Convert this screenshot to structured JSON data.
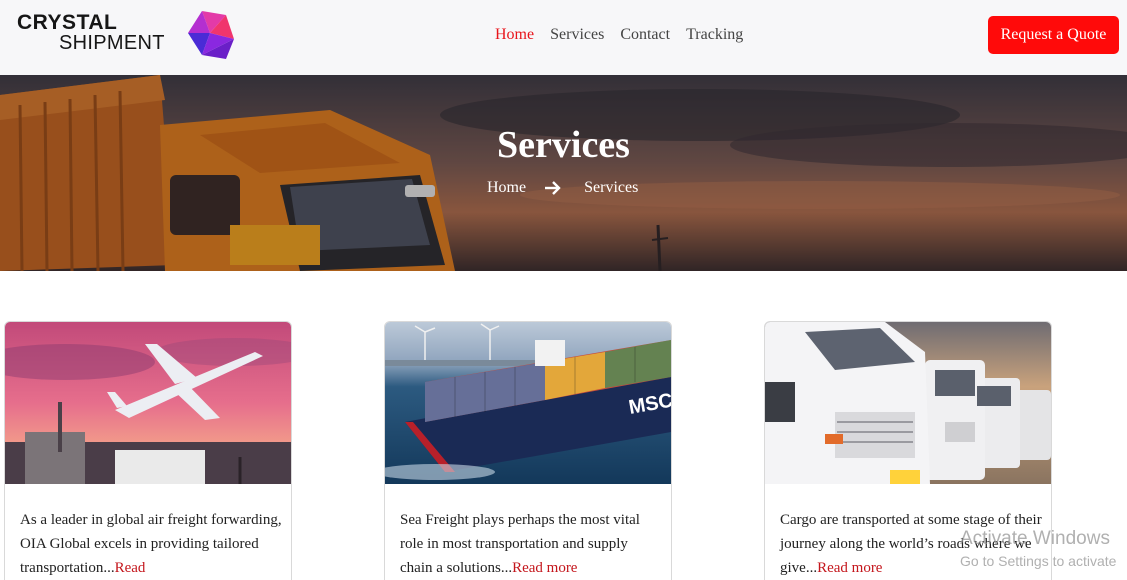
{
  "brand": {
    "name_line1": "CRYSTAL",
    "name_line2": "SHIPMENT",
    "logo_icon": "crystal-cube-icon"
  },
  "nav": {
    "items": [
      {
        "label": "Home",
        "active": true
      },
      {
        "label": "Services",
        "active": false
      },
      {
        "label": "Contact",
        "active": false
      },
      {
        "label": "Tracking",
        "active": false
      }
    ],
    "cta_label": "Request a Quote"
  },
  "colors": {
    "accent": "#ff0a0a",
    "active_nav": "#e8141b",
    "read_more": "#c4161c"
  },
  "hero": {
    "title": "Services",
    "breadcrumb_home": "Home",
    "breadcrumb_separator_icon": "arrow-right-icon",
    "breadcrumb_current": "Services"
  },
  "cards": [
    {
      "image": "air-freight-plane-image",
      "text": "As a leader in global air freight forwarding, OIA Global excels in providing tailored transportation...",
      "link": "Read"
    },
    {
      "image": "container-ship-image",
      "text": "Sea Freight plays perhaps the most vital role in most transportation and supply chain a solutions...",
      "link": "Read more"
    },
    {
      "image": "cargo-trucks-image",
      "text": "Cargo are transported at some stage of their journey along the world’s roads where we give...",
      "link": "Read more"
    }
  ],
  "os_watermark": {
    "line1": "Activate Windows",
    "line2": "Go to Settings to activate"
  }
}
